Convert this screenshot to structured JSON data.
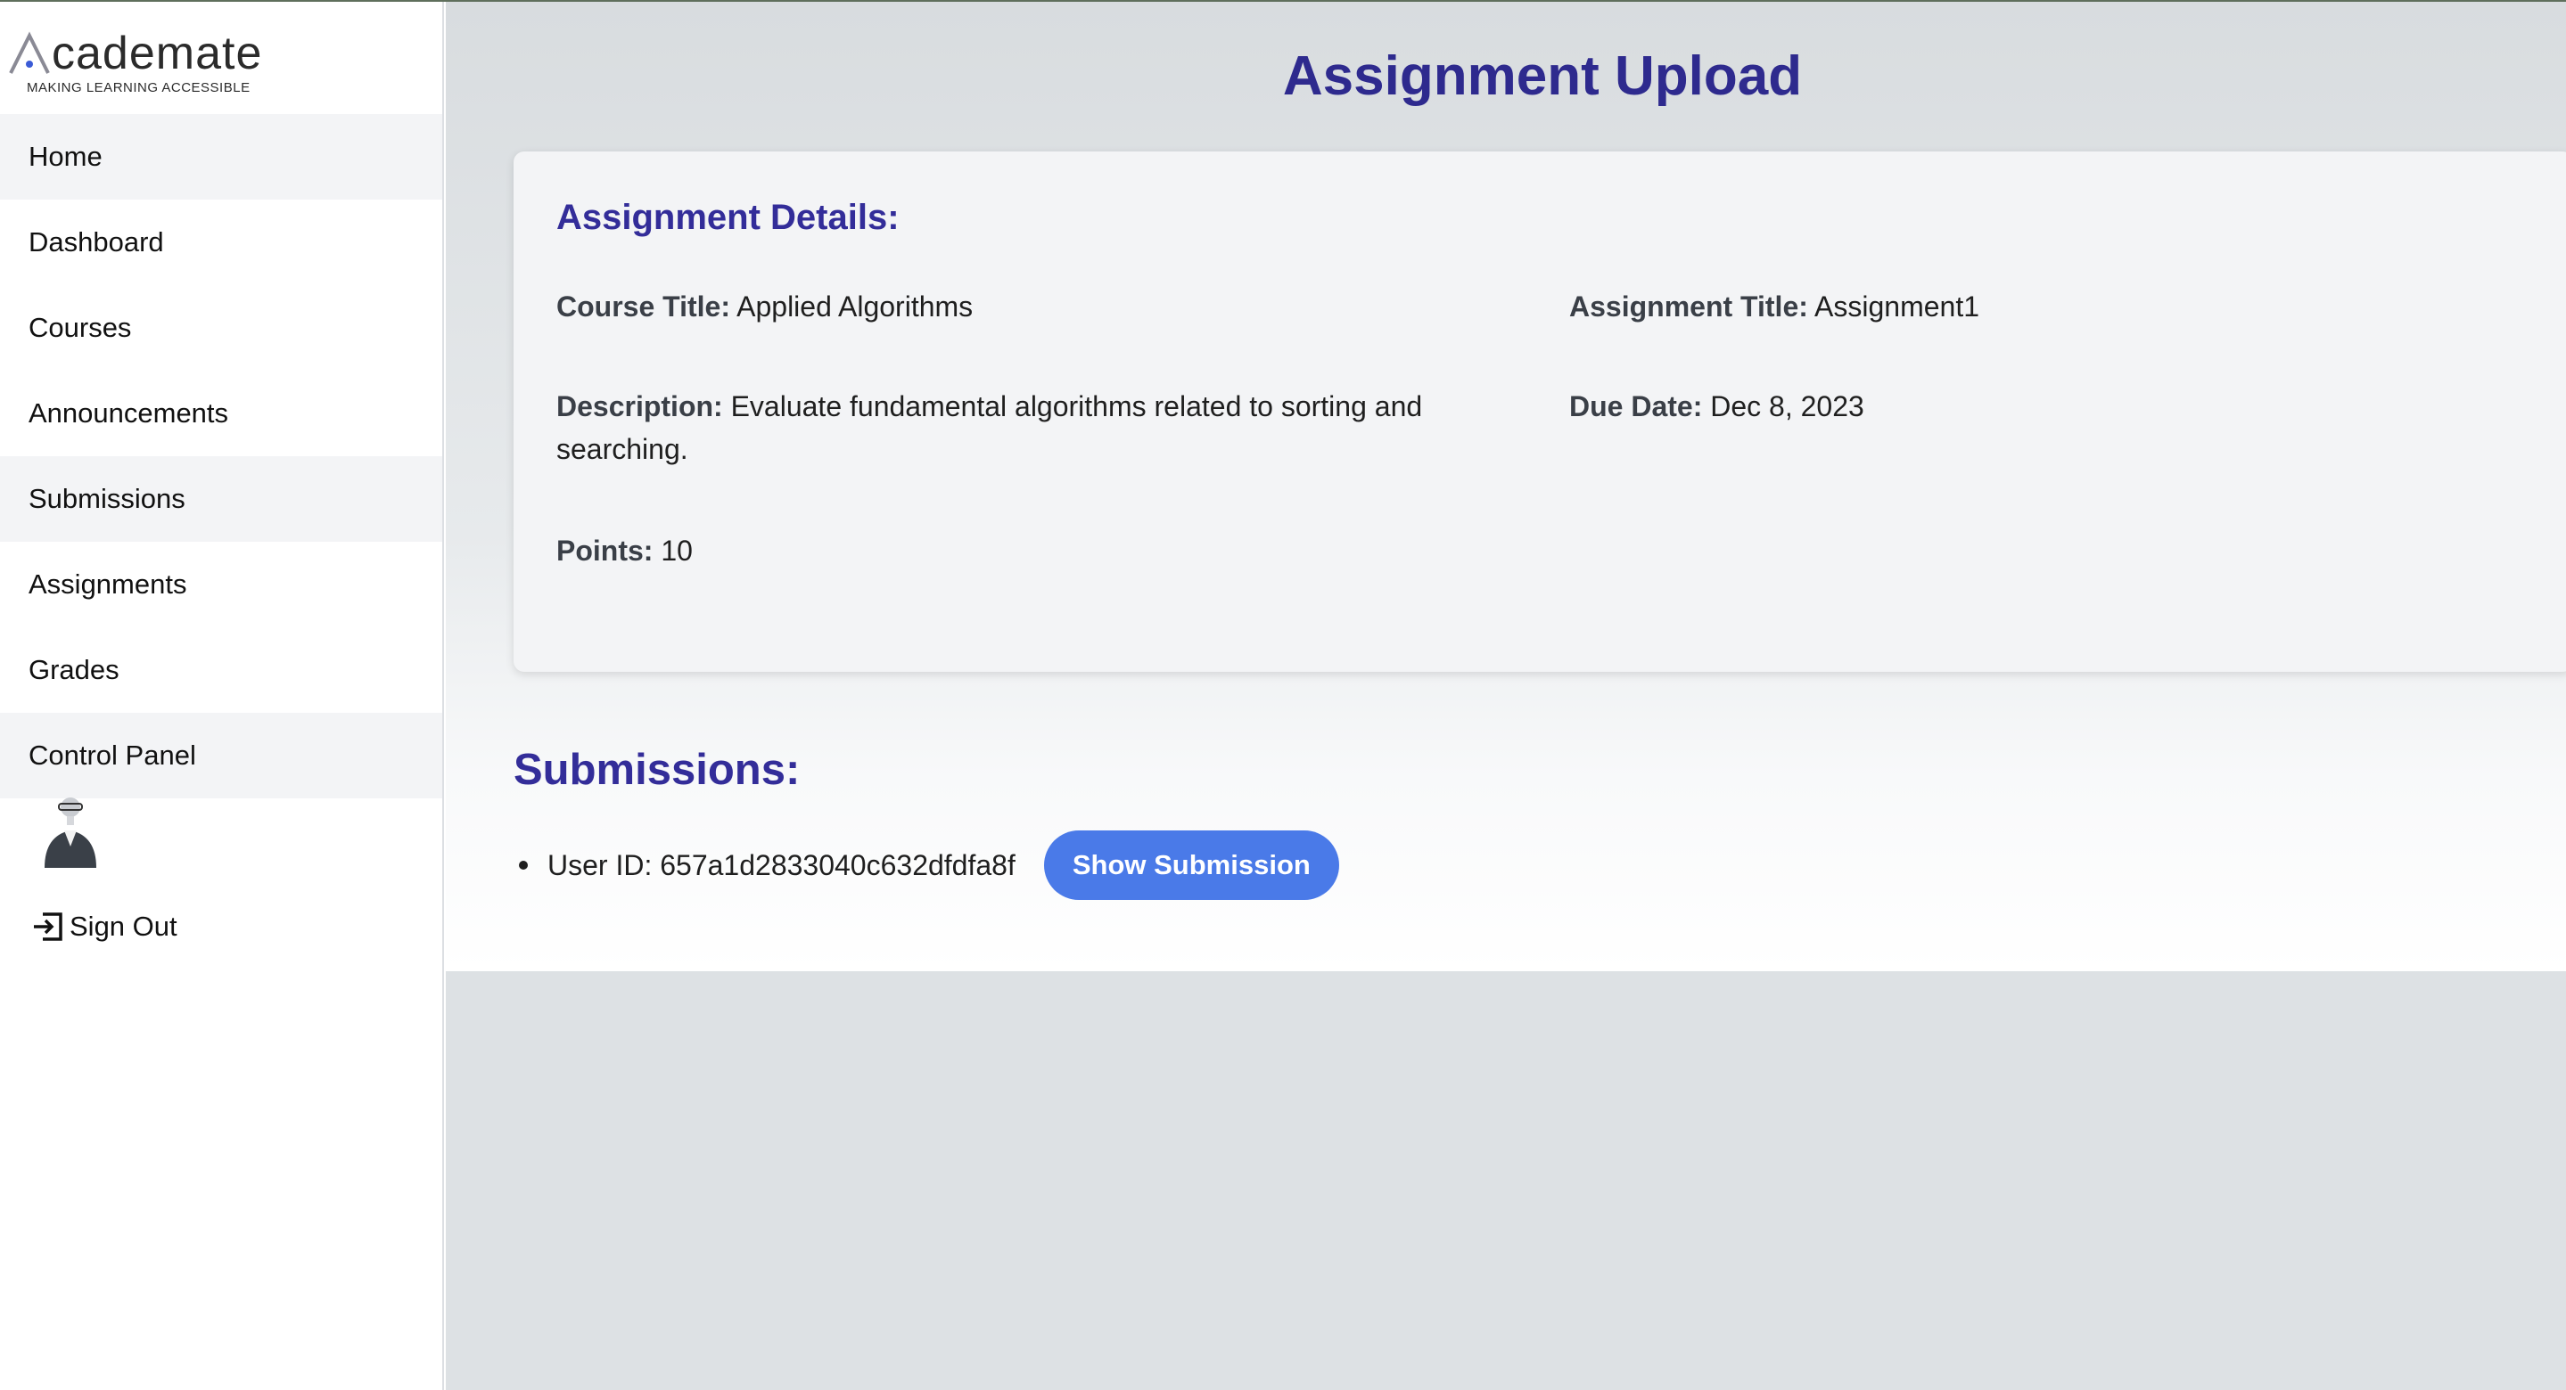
{
  "logo": {
    "wordmark": "cademate",
    "tagline": "MAKING LEARNING ACCESSIBLE"
  },
  "sidebar": {
    "items": [
      {
        "label": "Home"
      },
      {
        "label": "Dashboard"
      },
      {
        "label": "Courses"
      },
      {
        "label": "Announcements"
      },
      {
        "label": "Submissions"
      },
      {
        "label": "Assignments"
      },
      {
        "label": "Grades"
      },
      {
        "label": "Control Panel"
      }
    ],
    "signout_label": "Sign Out"
  },
  "page": {
    "title": "Assignment Upload"
  },
  "details": {
    "heading": "Assignment Details:",
    "course_title_label": "Course Title:",
    "course_title": "Applied Algorithms",
    "assignment_title_label": "Assignment Title:",
    "assignment_title": "Assignment1",
    "description_label": "Description:",
    "description": "Evaluate fundamental algorithms related to sorting and searching.",
    "due_date_label": "Due Date:",
    "due_date": "Dec 8, 2023",
    "points_label": "Points:",
    "points": "10"
  },
  "submissions": {
    "heading": "Submissions:",
    "items": [
      {
        "user_id_text": "User ID: 657a1d2833040c632dfdfa8f",
        "button_label": "Show Submission"
      }
    ]
  },
  "colors": {
    "accent": "#332d99",
    "button": "#4a7ae8"
  }
}
